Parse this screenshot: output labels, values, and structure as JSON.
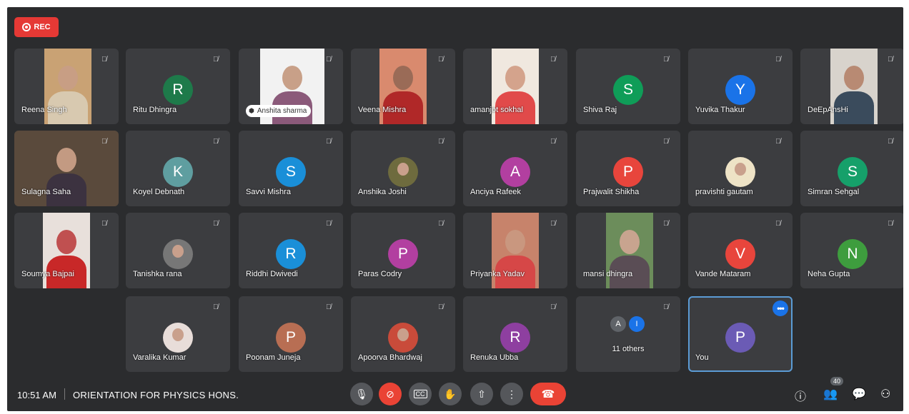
{
  "recording": {
    "label": "REC"
  },
  "colors": {
    "background": "#2b2c2e",
    "tile": "#3c3d40",
    "rec": "#e53935",
    "end_call": "#ea4335",
    "selected_border": "#5b9bd5"
  },
  "participants": [
    {
      "name": "Reena Singh",
      "type": "video"
    },
    {
      "name": "Ritu Dhingra",
      "type": "avatar",
      "initial": "R",
      "color": "#1e7a4a"
    },
    {
      "name": "Anshita sharma",
      "type": "video"
    },
    {
      "name": "Veena Mishra",
      "type": "video"
    },
    {
      "name": "amanjot sokhal",
      "type": "video"
    },
    {
      "name": "Shiva Raj",
      "type": "avatar",
      "initial": "S",
      "color": "#0f9d58"
    },
    {
      "name": "Yuvika Thakur",
      "type": "avatar",
      "initial": "Y",
      "color": "#1a73e8"
    },
    {
      "name": "DeEpAnsHi",
      "type": "video"
    },
    {
      "name": "Sulagna Saha",
      "type": "video"
    },
    {
      "name": "Koyel Debnath",
      "type": "avatar",
      "initial": "K",
      "color": "#5f9ea0"
    },
    {
      "name": "Savvi Mishra",
      "type": "avatar",
      "initial": "S",
      "color": "#1a8fd8"
    },
    {
      "name": "Anshika Joshi",
      "type": "photo"
    },
    {
      "name": "Anciya Rafeek",
      "type": "avatar",
      "initial": "A",
      "color": "#b23fa0"
    },
    {
      "name": "Prajwalit Shikha",
      "type": "avatar",
      "initial": "P",
      "color": "#e8453c"
    },
    {
      "name": "pravishti gautam",
      "type": "photo"
    },
    {
      "name": "Simran Sehgal",
      "type": "avatar",
      "initial": "S",
      "color": "#16a06a"
    },
    {
      "name": "Soumya Bajpai",
      "type": "video"
    },
    {
      "name": "Tanishka rana",
      "type": "photo"
    },
    {
      "name": "Riddhi Dwivedi",
      "type": "avatar",
      "initial": "R",
      "color": "#1a8fd8"
    },
    {
      "name": "Paras Codry",
      "type": "avatar",
      "initial": "P",
      "color": "#b23fa0"
    },
    {
      "name": "Priyanka Yadav",
      "type": "video"
    },
    {
      "name": "mansi dhingra",
      "type": "video"
    },
    {
      "name": "Vande Mataram",
      "type": "avatar",
      "initial": "V",
      "color": "#e8453c"
    },
    {
      "name": "Neha Gupta",
      "type": "avatar",
      "initial": "N",
      "color": "#3e9d3e"
    },
    {
      "name": "Varalika Kumar",
      "type": "photo"
    },
    {
      "name": "Poonam Juneja",
      "type": "avatar",
      "initial": "P",
      "color": "#b86e53"
    },
    {
      "name": "Apoorva Bhardwaj",
      "type": "photo"
    },
    {
      "name": "Renuka Ubba",
      "type": "avatar",
      "initial": "R",
      "color": "#8e3fa0"
    },
    {
      "name": "11 others",
      "type": "others",
      "initials": [
        "A",
        "I"
      ]
    },
    {
      "name": "You",
      "type": "avatar",
      "initial": "P",
      "color": "#6b5bb5"
    }
  ],
  "bottom_bar": {
    "time": "10:51 AM",
    "meeting_title": "ORIENTATION FOR PHYSICS HONS.",
    "participant_count": "40",
    "controls": [
      "mic-icon",
      "camera-off-icon",
      "captions-icon",
      "raise-hand-icon",
      "present-icon",
      "more-icon",
      "end-call-icon"
    ],
    "right_icons": [
      "info-icon",
      "people-icon",
      "chat-icon",
      "activities-icon"
    ]
  }
}
